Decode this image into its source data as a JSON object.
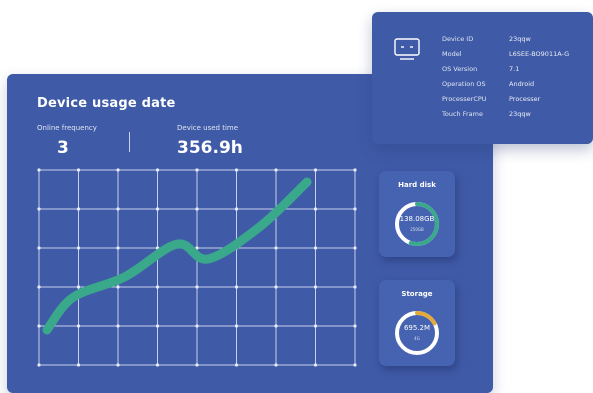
{
  "usage": {
    "title": "Device usage date",
    "online_label": "Online frequency",
    "online_value": "3",
    "time_label": "Device used time",
    "time_value": "356.9h"
  },
  "chart_data": {
    "type": "line",
    "line_color": "#3aa88a",
    "grid": true,
    "points": [
      {
        "x": 0.0,
        "y": 0.0
      },
      {
        "x": 0.1,
        "y": 0.22
      },
      {
        "x": 0.3,
        "y": 0.36
      },
      {
        "x": 0.5,
        "y": 0.58
      },
      {
        "x": 0.62,
        "y": 0.48
      },
      {
        "x": 0.82,
        "y": 0.7
      },
      {
        "x": 1.0,
        "y": 1.0
      }
    ]
  },
  "hard_disk": {
    "title": "Hard disk",
    "value": "138.08GB",
    "sub": "250GB",
    "fraction": 0.55,
    "color": "#3aa88a"
  },
  "storage": {
    "title": "Storage",
    "value": "695.2M",
    "sub": "4G",
    "fraction": 0.17,
    "color": "#e3a93a"
  },
  "device_info": {
    "icon": "monitor-icon",
    "rows": [
      {
        "label": "Device ID",
        "value": "23qqw"
      },
      {
        "label": "Model",
        "value": "L6SEE-BO9011A-G"
      },
      {
        "label": "OS Version",
        "value": "7.1"
      },
      {
        "label": "Operation OS",
        "value": "Android"
      },
      {
        "label": "ProcesserCPU",
        "value": "Processer"
      },
      {
        "label": "Touch Frame",
        "value": "23qqw"
      }
    ]
  }
}
